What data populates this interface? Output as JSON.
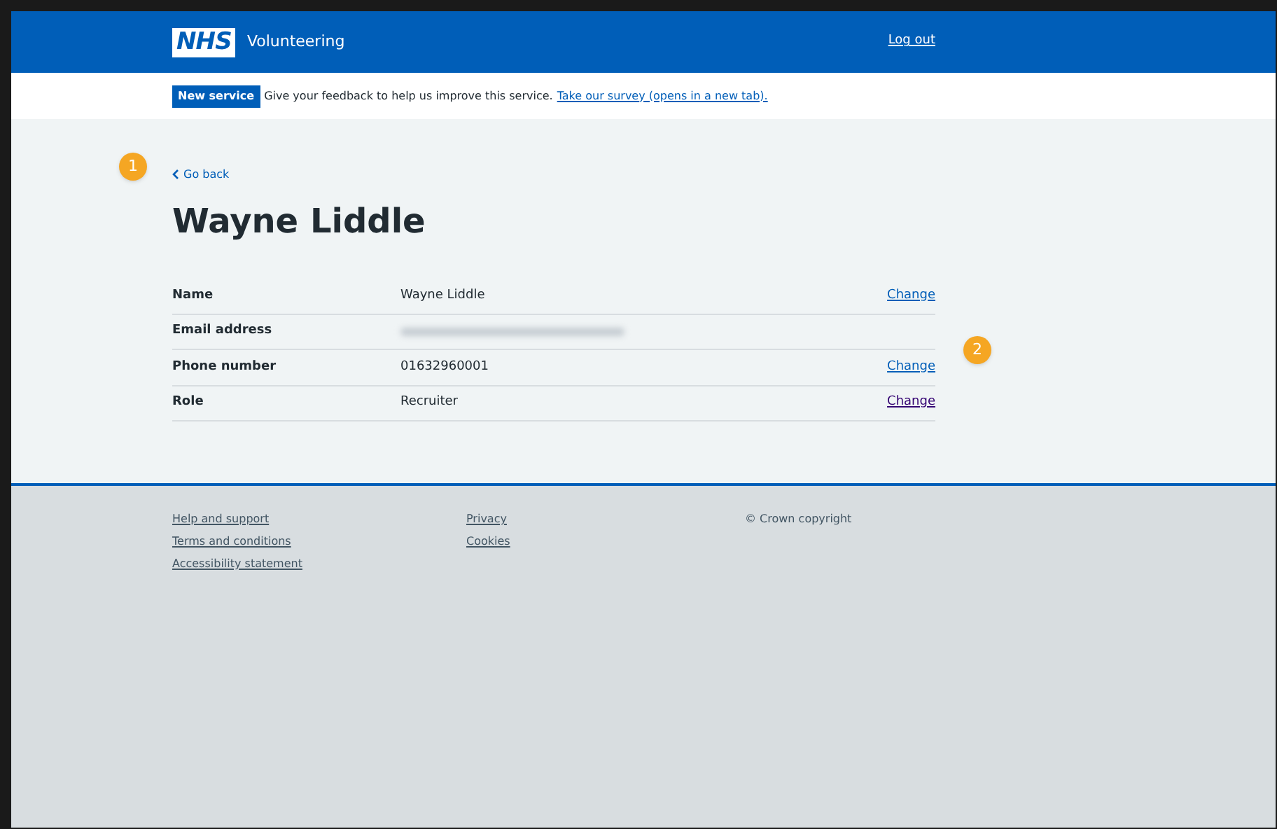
{
  "header": {
    "logo": "NHS",
    "service_name": "Volunteering",
    "log_out": "Log out"
  },
  "banner": {
    "tag": "New service",
    "text": "Give your feedback to help us improve this service.",
    "link": "Take our survey (opens in a new tab)."
  },
  "back_link": "Go back",
  "heading": "Wayne Liddle",
  "summary": [
    {
      "key": "Name",
      "value": "Wayne Liddle",
      "action": "Change",
      "visited": false,
      "redacted": false
    },
    {
      "key": "Email address",
      "redacted": true
    },
    {
      "key": "Phone number",
      "value": "01632960001",
      "action": "Change",
      "visited": false,
      "redacted": false
    },
    {
      "key": "Role",
      "value": "Recruiter",
      "action": "Change",
      "visited": true,
      "redacted": false
    }
  ],
  "callouts": [
    {
      "label": "1"
    },
    {
      "label": "2"
    }
  ],
  "footer": {
    "columns": [
      [
        "Help and support",
        "Terms and conditions",
        "Accessibility statement"
      ],
      [
        "Privacy",
        "Cookies"
      ]
    ],
    "copyright": "© Crown copyright"
  }
}
